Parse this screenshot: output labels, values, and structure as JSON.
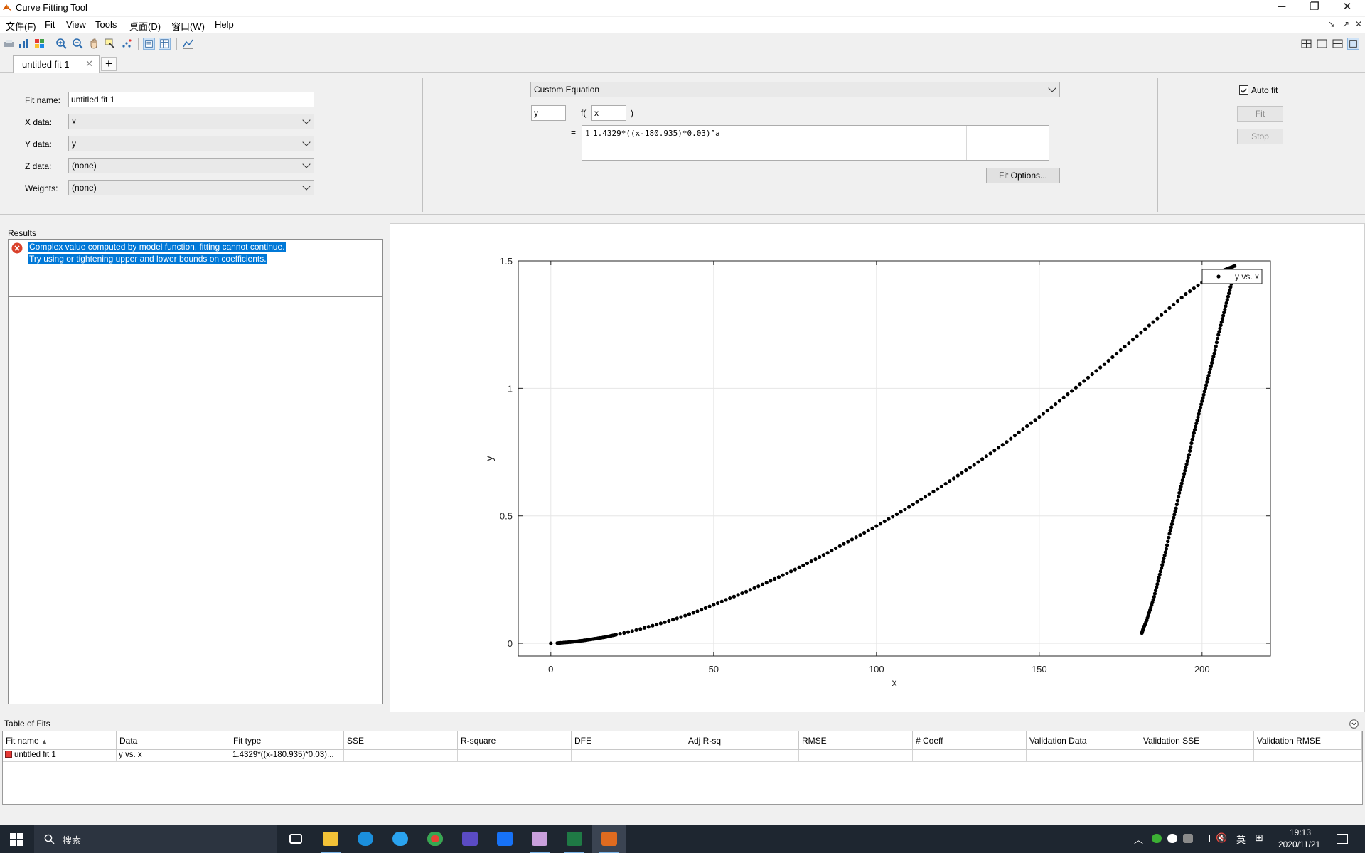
{
  "window": {
    "title": "Curve Fitting Tool"
  },
  "menu": [
    "文件(F)",
    "Fit",
    "View",
    "Tools",
    "桌面(D)",
    "窗口(W)",
    "Help"
  ],
  "tabs": [
    {
      "label": "untitled fit 1"
    }
  ],
  "fit": {
    "name_label": "Fit name:",
    "name_value": "untitled fit 1",
    "xdata_label": "X data:",
    "xdata_value": "x",
    "ydata_label": "Y data:",
    "ydata_value": "y",
    "zdata_label": "Z data:",
    "zdata_value": "(none)",
    "weights_label": "Weights:",
    "weights_value": "(none)",
    "type_value": "Custom Equation",
    "dep_var": "y",
    "eq_sign": "=",
    "func_open": "f(",
    "indep_var": "x",
    "func_close": ")",
    "expr_line": "1",
    "expression": "1.4329*((x-180.935)*0.03)^a",
    "fit_options": "Fit Options...",
    "auto_fit_label": "Auto fit",
    "fit_button": "Fit",
    "stop_button": "Stop"
  },
  "results": {
    "label": "Results",
    "error_line1": "Complex value computed by model function, fitting cannot continue.",
    "error_line2": "Try using or tightening upper and lower bounds on coefficients."
  },
  "chart_data": {
    "type": "scatter",
    "xlabel": "x",
    "ylabel": "y",
    "xlim": [
      -10,
      221
    ],
    "ylim": [
      -0.05,
      1.5
    ],
    "xticks": [
      0,
      50,
      100,
      150,
      200
    ],
    "yticks": [
      0,
      0.5,
      1,
      1.5
    ],
    "ytick_labels": [
      "0",
      "0.5",
      "1",
      "1.5"
    ],
    "grid": true,
    "legend": {
      "position": "top-right",
      "entries": [
        "y vs. x"
      ]
    },
    "series": [
      {
        "name": "y vs. x",
        "x": [
          0,
          2,
          4,
          6,
          8,
          10,
          12,
          14,
          16,
          18,
          20,
          25,
          30,
          35,
          40,
          45,
          50,
          55,
          60,
          65,
          70,
          75,
          80,
          85,
          90,
          95,
          100,
          105,
          110,
          115,
          120,
          125,
          130,
          135,
          140,
          145,
          150,
          155,
          160,
          165,
          170,
          175,
          180,
          185,
          190,
          195,
          200,
          203,
          206,
          208,
          210,
          209,
          208,
          207,
          206,
          205,
          204,
          203,
          202,
          201,
          200,
          199,
          198,
          197,
          196,
          195,
          194,
          193,
          192,
          191,
          190,
          189,
          188,
          187,
          186,
          185,
          184,
          183,
          182,
          181.5
        ],
        "y": [
          0,
          0.001,
          0.003,
          0.005,
          0.008,
          0.011,
          0.015,
          0.019,
          0.023,
          0.028,
          0.034,
          0.048,
          0.065,
          0.083,
          0.103,
          0.126,
          0.151,
          0.177,
          0.203,
          0.231,
          0.26,
          0.29,
          0.322,
          0.355,
          0.39,
          0.425,
          0.46,
          0.497,
          0.535,
          0.575,
          0.615,
          0.658,
          0.7,
          0.745,
          0.79,
          0.84,
          0.888,
          0.938,
          0.99,
          1.042,
          1.095,
          1.15,
          1.205,
          1.26,
          1.315,
          1.37,
          1.415,
          1.44,
          1.46,
          1.47,
          1.48,
          1.41,
          1.36,
          1.31,
          1.26,
          1.21,
          1.15,
          1.1,
          1.05,
          1.0,
          0.95,
          0.9,
          0.85,
          0.8,
          0.74,
          0.69,
          0.64,
          0.59,
          0.53,
          0.48,
          0.43,
          0.37,
          0.32,
          0.27,
          0.22,
          0.17,
          0.13,
          0.09,
          0.06,
          0.04
        ]
      }
    ]
  },
  "table_of_fits": {
    "label": "Table of Fits",
    "columns": [
      "Fit name",
      "Data",
      "Fit type",
      "SSE",
      "R-square",
      "DFE",
      "Adj R-sq",
      "RMSE",
      "# Coeff",
      "Validation Data",
      "Validation SSE",
      "Validation RMSE"
    ],
    "rows": [
      [
        "untitled fit 1",
        "y vs. x",
        "1.4329*((x-180.935)*0.03)...",
        "",
        "",
        "",
        "",
        "",
        "",
        "",
        "",
        ""
      ]
    ]
  },
  "taskbar": {
    "search_placeholder": "搜索",
    "ime": "英",
    "time": "19:13",
    "date": "2020/11/21"
  },
  "colors": {
    "selection": "#0078d7",
    "error": "#d9412b",
    "taskbar": "#1e2630"
  }
}
